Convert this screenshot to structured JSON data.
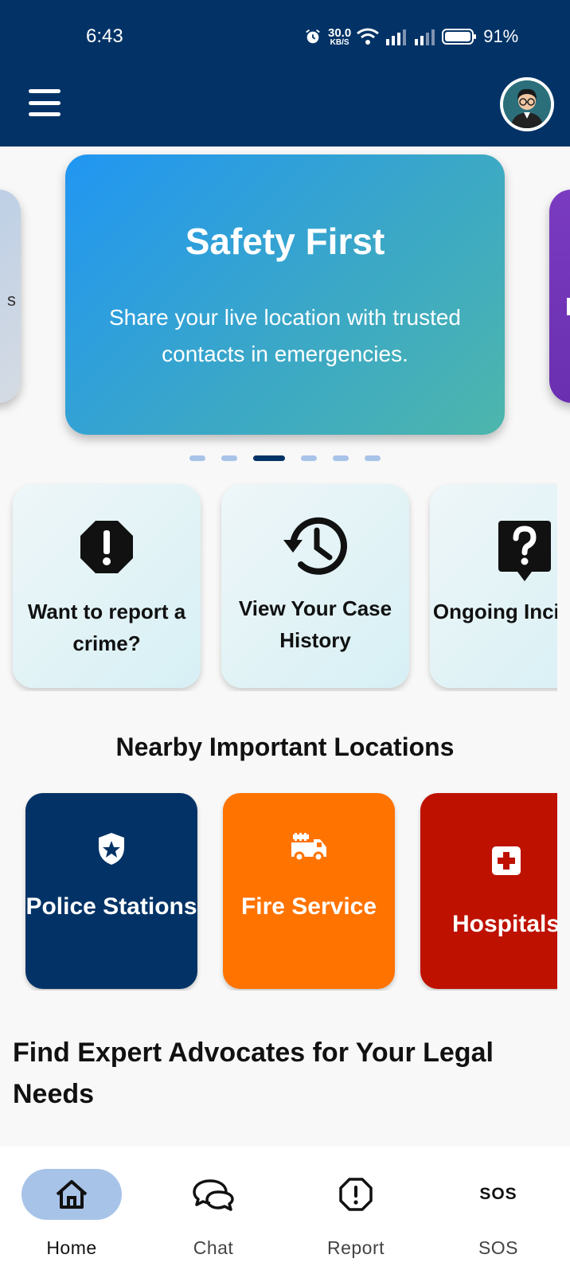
{
  "status_bar": {
    "time": "6:43",
    "net_speed_value": "30.0",
    "net_speed_unit": "KB/S",
    "battery": "91%"
  },
  "header": {
    "menu_icon": "hamburger-menu-icon",
    "avatar": "user-avatar"
  },
  "carousel": {
    "title": "Safety First",
    "text": "Share your live location with trusted contacts in emergencies.",
    "prev_partial_text": "s",
    "active_index": 2,
    "slide_count": 6
  },
  "quick_actions": [
    {
      "label": "Want to report a crime?",
      "icon": "alert-octagon-icon"
    },
    {
      "label": "View Your Case History",
      "icon": "history-icon"
    },
    {
      "label": "Ongoing Incidents",
      "icon": "question-message-icon"
    }
  ],
  "nearby": {
    "title": "Nearby Important Locations",
    "cards": [
      {
        "label": "Police Stations",
        "icon": "police-shield-icon",
        "color": "#033366"
      },
      {
        "label": "Fire Service",
        "icon": "fire-truck-icon",
        "color": "#FF7300"
      },
      {
        "label": "Hospitals",
        "icon": "medical-cross-icon",
        "color": "#BE1100"
      }
    ]
  },
  "advocates": {
    "title": "Find Expert Advocates for Your Legal Needs"
  },
  "bottom_nav": {
    "items": [
      {
        "label": "Home",
        "icon": "home-icon",
        "active": true
      },
      {
        "label": "Chat",
        "icon": "chat-icon",
        "active": false
      },
      {
        "label": "Report",
        "icon": "report-icon",
        "active": false
      },
      {
        "label": "SOS",
        "icon": "sos-icon",
        "icon_text": "SOS",
        "active": false
      }
    ]
  },
  "colors": {
    "primary": "#033366",
    "nav_active": "#A8C3E8",
    "slide_gradient_start": "#2196F3",
    "slide_gradient_end": "#4DB6AC"
  }
}
